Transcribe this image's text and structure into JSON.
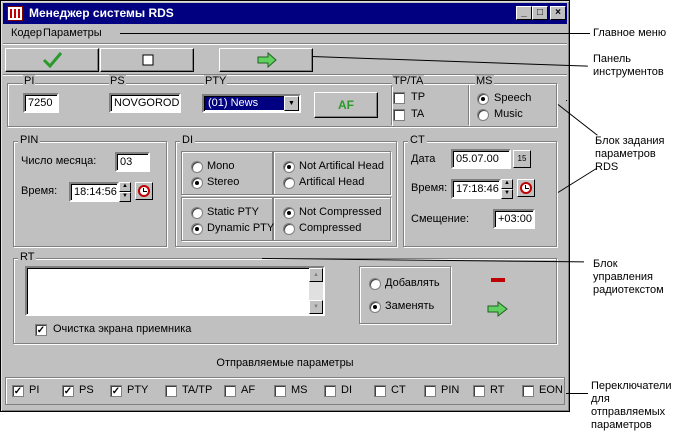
{
  "window": {
    "title": "Менеджер системы RDS",
    "min": "_",
    "max": "□",
    "close": "×"
  },
  "menu": {
    "items": [
      {
        "label": "Кодер"
      },
      {
        "label": "Параметры"
      }
    ]
  },
  "toolbar": {
    "apply_icon": "checkmark-icon",
    "stop_icon": "square-icon",
    "send_icon": "arrow-right-icon"
  },
  "pi": {
    "title": "PI",
    "value": "7250"
  },
  "ps": {
    "title": "PS",
    "value": "NOVGOROD"
  },
  "pty": {
    "title": "PTY",
    "value": "(01)  News"
  },
  "af": {
    "label": "AF"
  },
  "tpta": {
    "title": "TP/TA",
    "tp": "TP",
    "ta": "TA"
  },
  "ms": {
    "title": "MS",
    "speech": "Speech",
    "music": "Music"
  },
  "pin": {
    "title": "PIN",
    "day_label": "Число месяца:",
    "day_value": "03",
    "time_label": "Время:",
    "time_value": "18:14:56"
  },
  "di": {
    "title": "DI",
    "mono": "Mono",
    "stereo": "Stereo",
    "not_art": "Not Artifical Head",
    "art": "Artifical Head",
    "static_pty": "Static PTY",
    "dynamic_pty": "Dynamic PTY",
    "not_comp": "Not Compressed",
    "comp": "Compressed"
  },
  "ct": {
    "title": "CT",
    "date_label": "Дата",
    "date_value": "05.07.00",
    "cal_label": "15",
    "time_label": "Время:",
    "time_value": "17:18:46",
    "offset_label": "Смещение:",
    "offset_value": "+03:00"
  },
  "rt": {
    "title": "RT",
    "text": "",
    "add": "Добавлять",
    "replace": "Заменять",
    "clear_label": "Очистка экрана приемника"
  },
  "send_params": {
    "label": "Отправляемые параметры",
    "items": [
      {
        "label": "PI",
        "checked": true
      },
      {
        "label": "PS",
        "checked": true
      },
      {
        "label": "PTY",
        "checked": true
      },
      {
        "label": "TA/TP",
        "checked": false
      },
      {
        "label": "AF",
        "checked": false
      },
      {
        "label": "MS",
        "checked": false
      },
      {
        "label": "DI",
        "checked": false
      },
      {
        "label": "CT",
        "checked": false
      },
      {
        "label": "PIN",
        "checked": false
      },
      {
        "label": "RT",
        "checked": false
      },
      {
        "label": "EON",
        "checked": false
      }
    ]
  },
  "annotations": {
    "main_menu": "Главное меню",
    "toolbar_1": "Панель",
    "toolbar_2": "инструментов",
    "rds_1": "Блок задания",
    "rds_2": "параметров",
    "rds_3": "RDS",
    "rt_1": "Блок",
    "rt_2": "управления",
    "rt_3": "радиотекстом",
    "sw_1": "Переключатели",
    "sw_2": "для",
    "sw_3": "отправляемых",
    "sw_4": "параметров"
  },
  "colors": {
    "titlebar": "#000080",
    "face": "#c0c0c0",
    "check_green": "#2a9a2a",
    "minus_red": "#c00000"
  }
}
